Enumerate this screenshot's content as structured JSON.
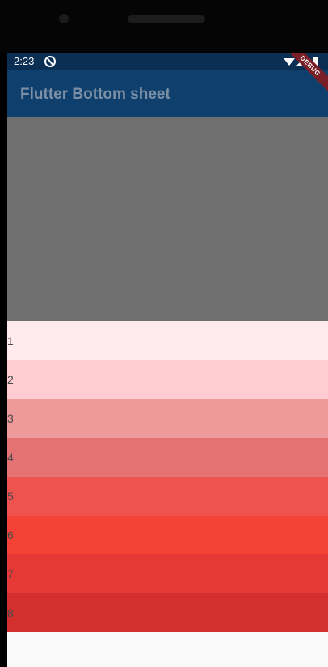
{
  "status_bar": {
    "time": "2:23",
    "background": "#0a2f53"
  },
  "app_bar": {
    "title": "Flutter Bottom sheet",
    "background": "#0f3f6d"
  },
  "debug_banner": {
    "label": "DEBUG"
  },
  "overlay": {
    "color": "#6f6f6f"
  },
  "list": {
    "items": [
      {
        "label": "1",
        "color": "#ffebee"
      },
      {
        "label": "2",
        "color": "#ffcdd2"
      },
      {
        "label": "3",
        "color": "#ef9a9a"
      },
      {
        "label": "4",
        "color": "#e57373"
      },
      {
        "label": "5",
        "color": "#ef5350"
      },
      {
        "label": "6",
        "color": "#f44336"
      },
      {
        "label": "7",
        "color": "#e53935"
      },
      {
        "label": "8",
        "color": "#d32f2f"
      }
    ]
  }
}
